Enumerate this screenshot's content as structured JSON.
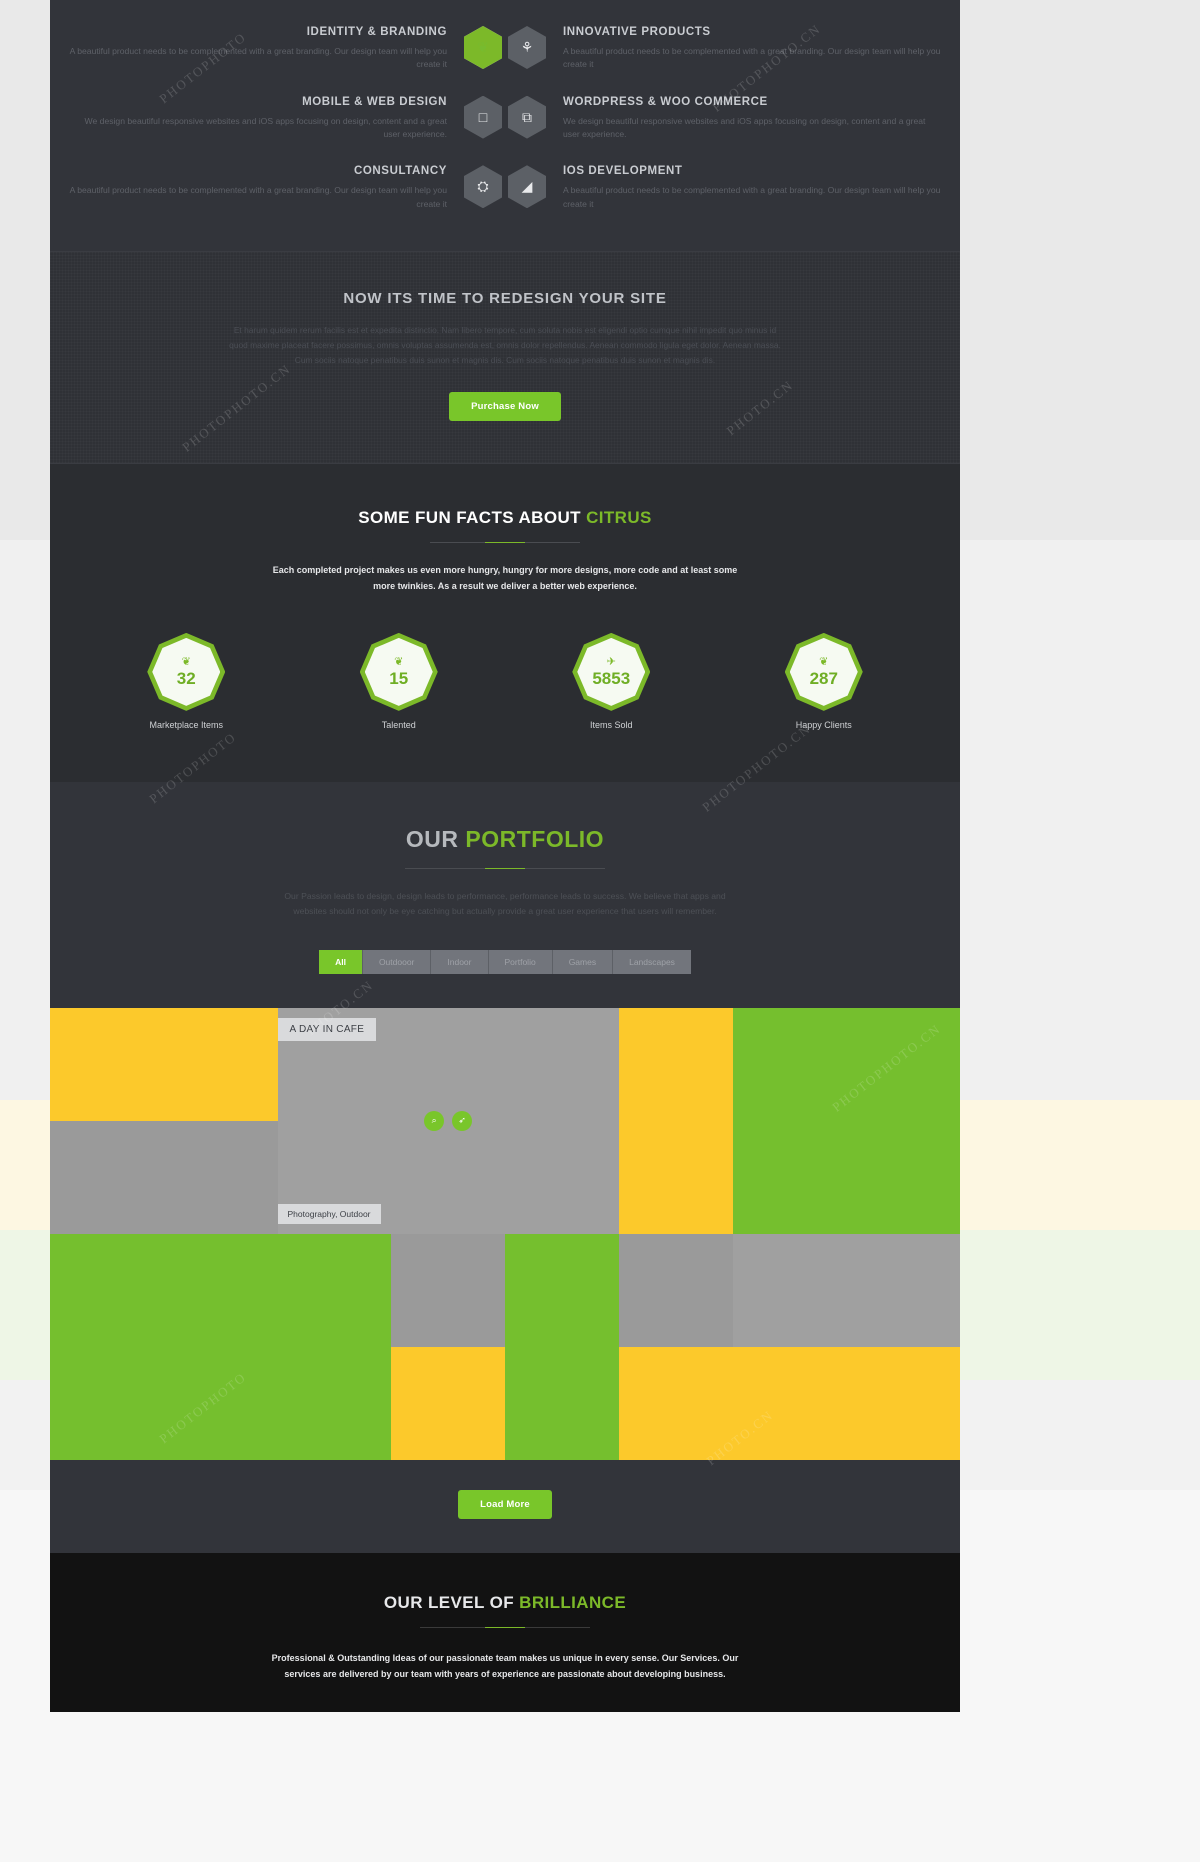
{
  "services": {
    "items": [
      {
        "title": "IDENTITY & BRANDING",
        "desc": "A beautiful product needs to be complemented with a great branding. Our design team will help you create it",
        "icon": "shield-icon",
        "glyph": "❦",
        "align": "left",
        "active": true
      },
      {
        "title": "INNOVATIVE PRODUCTS",
        "desc": "A beautiful product needs to be complemented with a great branding. Our design team will help you create it",
        "icon": "lightbulb-icon",
        "glyph": "⚘",
        "align": "right",
        "active": false
      },
      {
        "title": "MOBILE & WEB DESIGN",
        "desc": "We design beautiful responsive websites and iOS apps focusing on design, content and a great user experience.",
        "icon": "mobile-icon",
        "glyph": "□",
        "align": "left",
        "active": false
      },
      {
        "title": "WORDPRESS & WOO COMMERCE",
        "desc": "We design beautiful responsive websites and iOS apps focusing on design, content and a great user experience.",
        "icon": "layers-icon",
        "glyph": "⧉",
        "align": "right",
        "active": false
      },
      {
        "title": "CONSULTANCY",
        "desc": "A beautiful product needs to be complemented with a great branding. Our design team will help you create it",
        "icon": "share-nodes-icon",
        "glyph": "⛭",
        "align": "left",
        "active": false
      },
      {
        "title": "IOS DEVELOPMENT",
        "desc": "A beautiful product needs to be complemented with a great branding. Our design team will help you create it",
        "icon": "megaphone-icon",
        "glyph": "◢",
        "align": "right",
        "active": false
      }
    ]
  },
  "cta": {
    "heading": "NOW ITS TIME TO REDESIGN YOUR SITE",
    "paragraph": "Et harum quidem rerum facilis est et expedita distinctio. Nam libero tempore, cum soluta nobis est eligendi optio cumque nihil impedit quo minus id quod maxime placeat facere possimus, omnis voluptas assumenda est, omnis dolor repellendus. Aenean commodo ligula eget dolor. Aenean massa. Cum sociis natoque penatibus duis sunon et magnis dis. Cum sociis natoque penatibus duis sunon et magnis dis.",
    "button_label": "Purchase Now"
  },
  "facts": {
    "heading_plain": "SOME FUN FACTS ABOUT ",
    "heading_highlight": "CITRUS",
    "subtitle": "Each completed project makes us even more hungry, hungry for more designs, more code and at least some more twinkies. As a result we deliver a better web experience.",
    "counters": [
      {
        "value": "32",
        "label": "Marketplace Items",
        "icon": "bug-icon",
        "glyph": "❦"
      },
      {
        "value": "15",
        "label": "Talented",
        "icon": "bug-icon",
        "glyph": "❦"
      },
      {
        "value": "5853",
        "label": "Items Sold",
        "icon": "rocket-icon",
        "glyph": "✈"
      },
      {
        "value": "287",
        "label": "Happy Clients",
        "icon": "twitter-icon",
        "glyph": "❦"
      }
    ]
  },
  "portfolio": {
    "heading_plain": "OUR ",
    "heading_highlight": "PORTFOLIO",
    "subtitle": "Our Passion leads to design, design leads to performance, performance leads to success. We believe that apps and websites should not only be eye catching but actually provide a great user experience that users will remember.",
    "filters": [
      {
        "label": "All",
        "active": true
      },
      {
        "label": "Outdooor",
        "active": false
      },
      {
        "label": "Indoor",
        "active": false
      },
      {
        "label": "Portfolio",
        "active": false
      },
      {
        "label": "Games",
        "active": false
      },
      {
        "label": "Landscapes",
        "active": false
      }
    ],
    "featured_tile": {
      "title": "A DAY IN CAFE",
      "category": "Photography, Outdoor",
      "zoom_icon": "magnifier-icon",
      "zoom_glyph": "⌕",
      "link_icon": "link-icon",
      "link_glyph": "➶"
    },
    "load_more_label": "Load More"
  },
  "brilliance": {
    "heading_plain": "OUR LEVEL OF ",
    "heading_highlight": "BRILLIANCE",
    "subtitle": "Professional & Outstanding Ideas of our passionate team makes us unique in every sense. Our Services. Our services are delivered by our team with years of experience are passionate about developing business."
  },
  "colors": {
    "accent_green": "#7cb929",
    "button_green": "#79c62a",
    "tile_yellow": "#fcc92b",
    "tile_green": "#75bf2e",
    "tile_gray": "#9a9a9a",
    "dark_panel": "#32343a",
    "darker_panel": "#2b2d31",
    "black_panel": "#121212"
  },
  "watermark": {
    "text_1": "PHOTOPHOTO",
    "text_2": "PHOTOPHOTO.CN",
    "text_3": "PHOTO.CN"
  }
}
